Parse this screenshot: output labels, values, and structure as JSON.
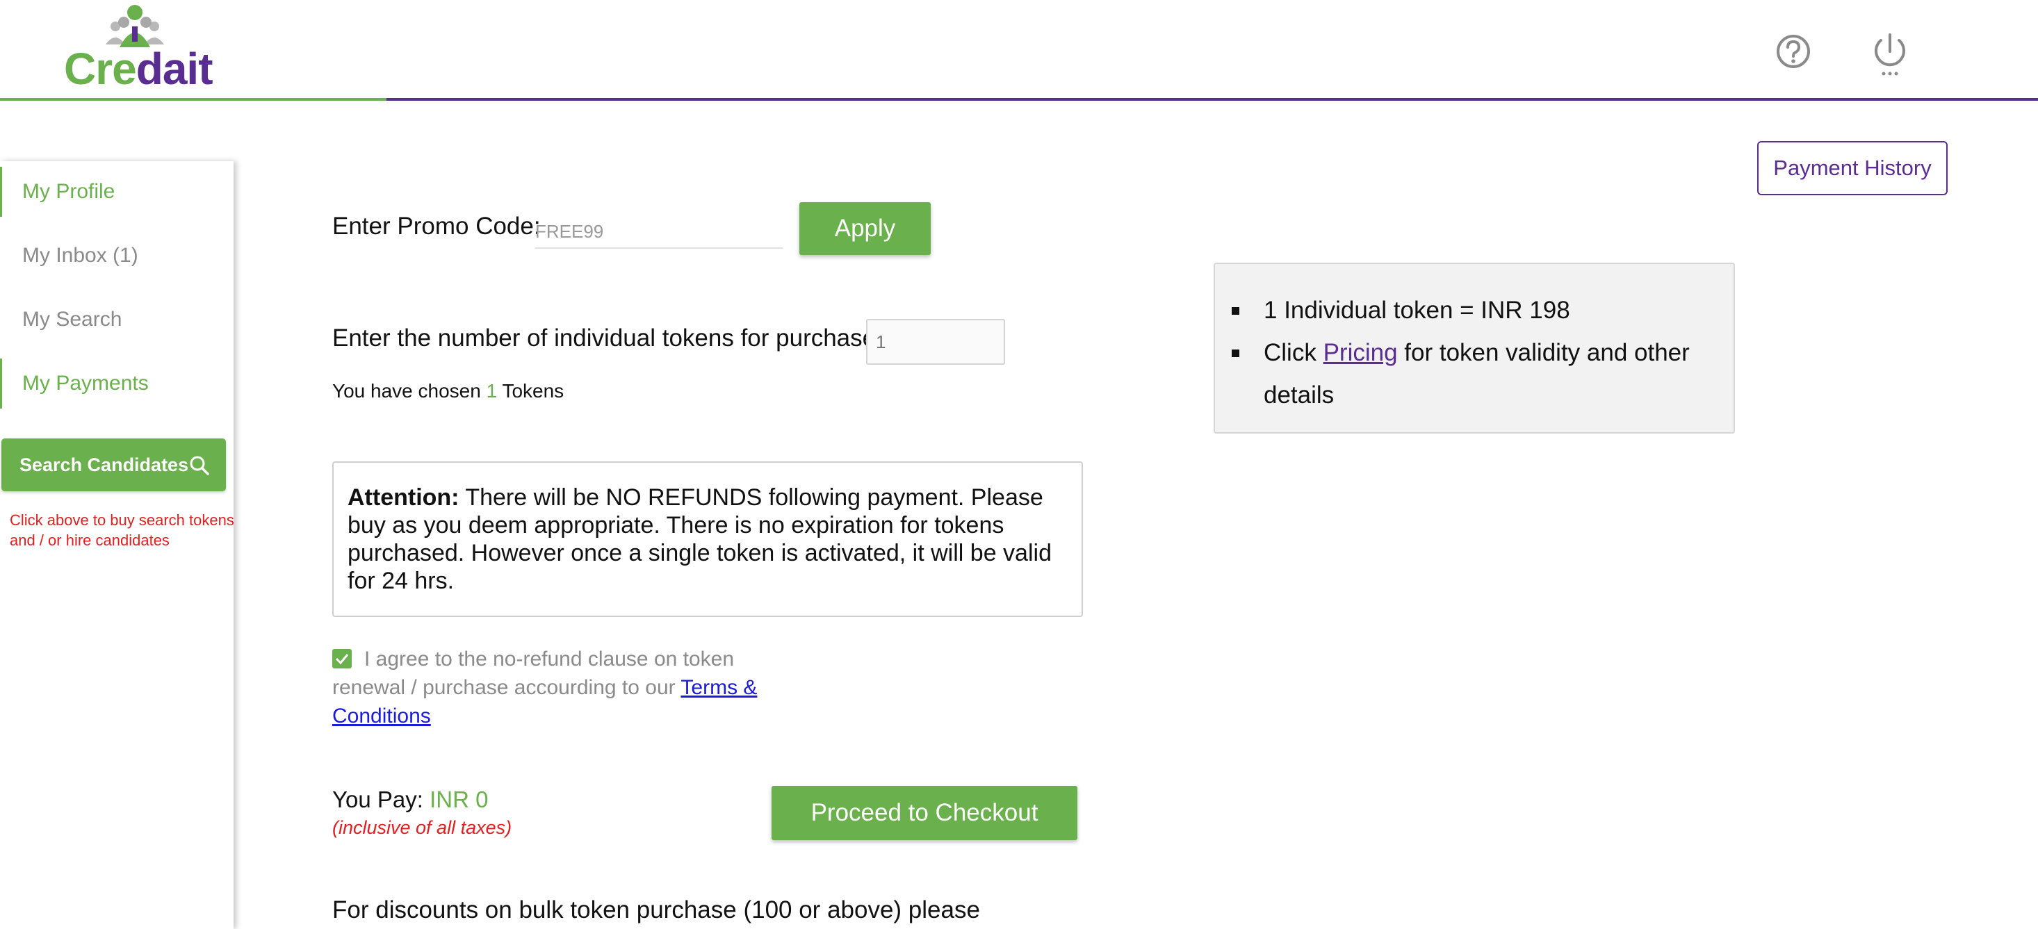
{
  "brand": {
    "logo_part1": "Cre",
    "logo_part2": "dait",
    "green": "#6ab04c",
    "purple": "#5a2d91"
  },
  "header": {
    "help_icon": "help-circle-icon",
    "power_icon": "power-icon"
  },
  "sidebar": {
    "items": [
      {
        "label": "My Profile",
        "active": true
      },
      {
        "label": "My Inbox (1)",
        "active": false
      },
      {
        "label": "My Search",
        "active": false
      },
      {
        "label": "My Payments",
        "active": true
      }
    ],
    "search_button": "Search Candidates",
    "search_note": "Click above to buy search tokens and / or hire candidates"
  },
  "main": {
    "payment_history": "Payment History",
    "promo": {
      "label": "Enter Promo Code:",
      "placeholder": "FREE99",
      "apply": "Apply"
    },
    "tokens": {
      "label": "Enter the number of individual tokens for purchase",
      "placeholder": "1",
      "chosen_prefix": "You have chosen ",
      "chosen_count": "1",
      "chosen_suffix": " Tokens"
    },
    "info": {
      "line1": "1 Individual token = INR 198",
      "line2_prefix": "Click ",
      "line2_link": "Pricing",
      "line2_suffix": " for token validity and other details"
    },
    "attention": {
      "heading": "Attention:",
      "text": " There will be NO REFUNDS following payment. Please buy as you deem appropriate. There is no expiration for tokens purchased. However once a single token is activated, it will be valid for 24 hrs."
    },
    "agree": {
      "checked": true,
      "text": "I agree to the no-refund clause on token renewal / purchase accourding to our ",
      "link": "Terms & Conditions"
    },
    "pay": {
      "label": "You Pay: ",
      "amount": "INR 0",
      "note": "(inclusive of all taxes)",
      "checkout": "Proceed to Checkout"
    },
    "bulk_text": "For discounts on bulk token purchase (100 or above) please"
  }
}
